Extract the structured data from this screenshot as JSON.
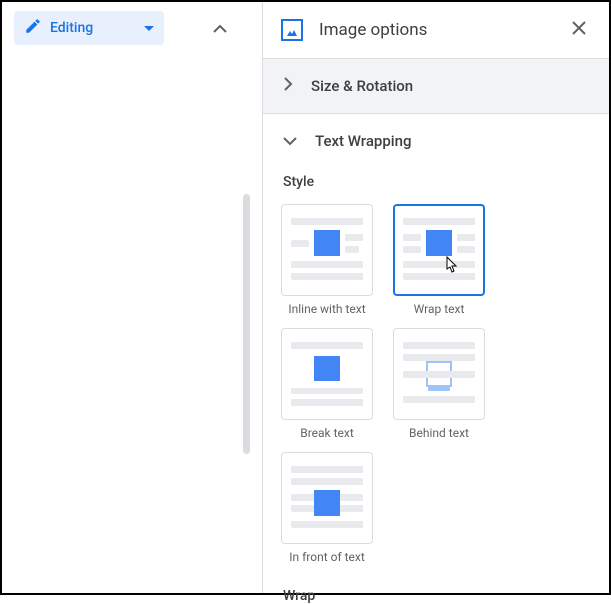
{
  "toolbar": {
    "editing_label": "Editing"
  },
  "panel": {
    "title": "Image options",
    "sections": {
      "size_rotation": "Size & Rotation",
      "text_wrapping": "Text Wrapping"
    },
    "style_heading": "Style",
    "wrap_heading": "Wrap",
    "styles": {
      "inline": "Inline with text",
      "wrap": "Wrap text",
      "break": "Break text",
      "behind": "Behind text",
      "front": "In front of text"
    }
  }
}
